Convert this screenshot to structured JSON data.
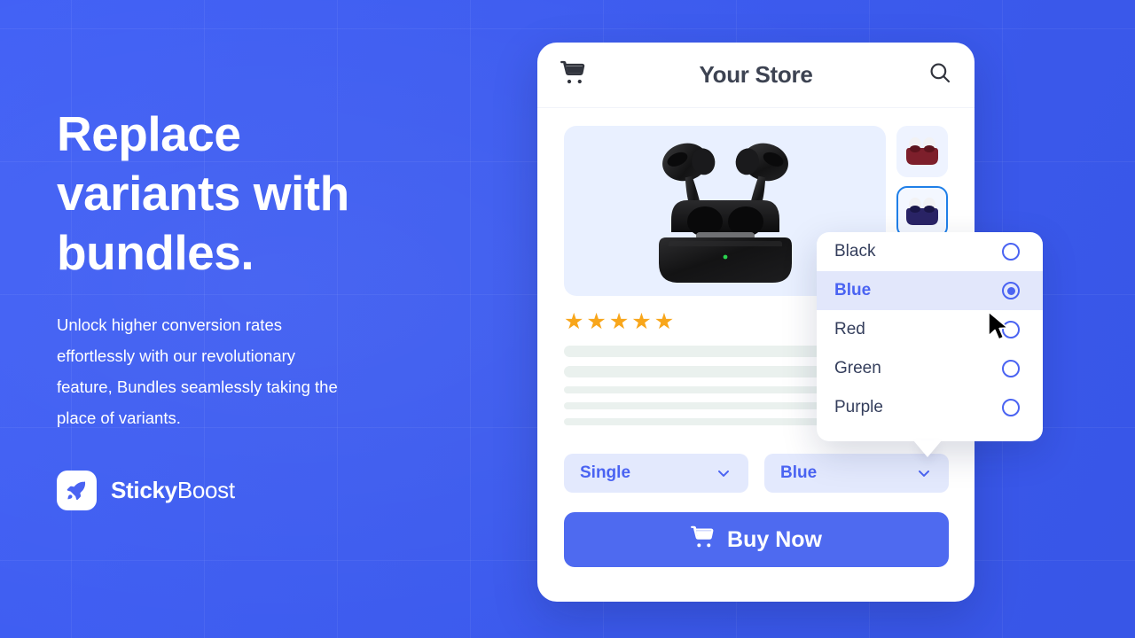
{
  "theme": {
    "background_blue": "#3b5bf5",
    "accent_blue": "#4a63f2",
    "button_blue": "#4e6af0",
    "highlight_lavender": "#e2e7fb",
    "star_orange": "#f8a61b",
    "skeleton_gray": "#eaf1ee"
  },
  "promo": {
    "headline": "Replace variants with bundles.",
    "body": "Unlock higher conversion rates effortlessly with our revolutionary feature, Bundles seamlessly taking the place of variants.",
    "brand_name_bold": "Sticky",
    "brand_name_light": "Boost",
    "brand_icon": "rocket-icon"
  },
  "store": {
    "title": "Your Store",
    "cart_icon": "shopping-cart-icon",
    "search_icon": "search-icon",
    "product": {
      "main_image_alt": "black-wireless-earbuds-in-case",
      "rating_stars": 5,
      "star_glyph": "★",
      "thumbnails": [
        {
          "color_name": "Red",
          "swatch": "#7d1f2b",
          "selected": false
        },
        {
          "color_name": "Purple",
          "swatch": "#2a2466",
          "selected": true
        }
      ],
      "description_placeholder_lines": [
        {
          "type": "thick"
        },
        {
          "type": "thick"
        },
        {
          "type": "thin"
        },
        {
          "type": "thin"
        },
        {
          "type": "thin"
        }
      ]
    },
    "selectors": [
      {
        "name": "bundle-select",
        "value": "Single",
        "chevron": "chevron-down-icon"
      },
      {
        "name": "color-select",
        "value": "Blue",
        "chevron": "chevron-down-icon"
      }
    ],
    "buy_button": {
      "label": "Buy Now",
      "icon": "shopping-cart-icon"
    },
    "dropdown": {
      "open": true,
      "options": [
        {
          "label": "Black",
          "selected": false
        },
        {
          "label": "Blue",
          "selected": true
        },
        {
          "label": "Red",
          "selected": false
        },
        {
          "label": "Green",
          "selected": false
        },
        {
          "label": "Purple",
          "selected": false
        }
      ]
    }
  },
  "cursor": {
    "type": "arrow-pointer"
  }
}
